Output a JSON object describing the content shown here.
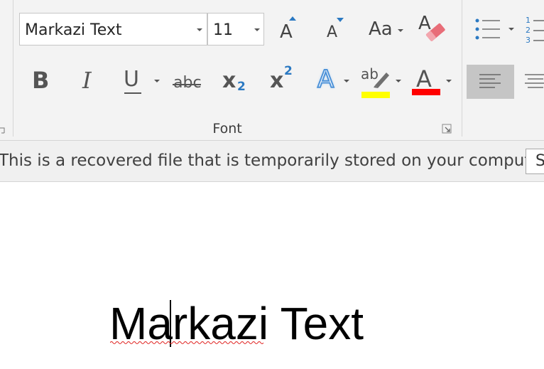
{
  "font_group": {
    "font_name": "Markazi Text",
    "font_size": "11",
    "group_label": "Font",
    "grow_font_glyph": "A",
    "shrink_font_glyph": "A",
    "change_case_glyph": "Aa",
    "clear_format_glyph": "A",
    "bold_glyph": "B",
    "italic_glyph": "I",
    "underline_glyph": "U",
    "strikethrough_glyph": "abc",
    "subscript_glyph": "x",
    "subscript_mark": "2",
    "superscript_glyph": "x",
    "superscript_mark": "2",
    "text_effects_glyph": "A",
    "highlight_glyph": "ab",
    "font_color_glyph": "A",
    "highlight_color": "#ffff00",
    "font_color": "#ff0000",
    "accent_blue": "#2b79c2"
  },
  "paragraph_group": {
    "numbering_marks": [
      "1",
      "2",
      "3"
    ]
  },
  "message_bar": {
    "text": "This is a recovered file that is temporarily stored on your computer.",
    "button_label": "S"
  },
  "document": {
    "text_before_caret": "Ma",
    "text_after_caret": "rkazi Text"
  }
}
